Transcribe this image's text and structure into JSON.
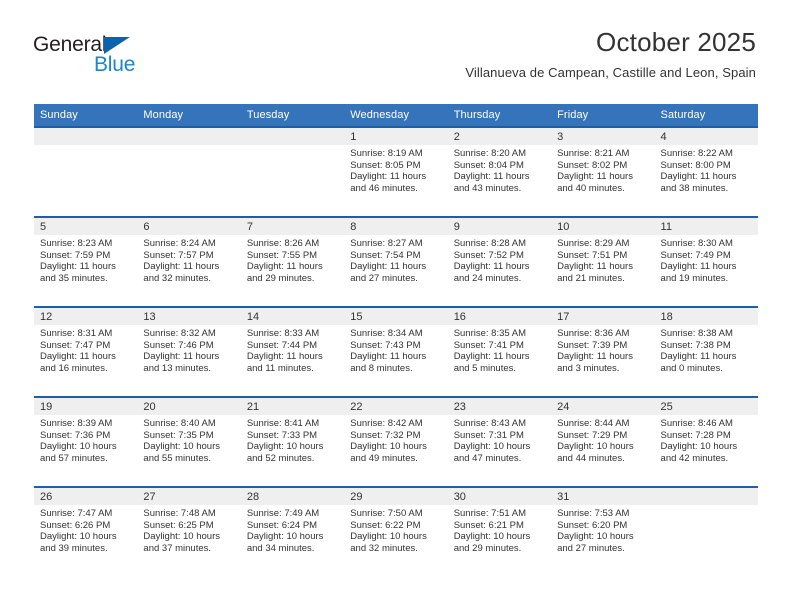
{
  "brand": {
    "name_part1": "General",
    "name_part2": "Blue",
    "accent_color": "#1a86d0",
    "triangle_color": "#0a63ab",
    "text_color": "#231f20"
  },
  "header": {
    "title": "October 2025",
    "subtitle": "Villanueva de Campean, Castille and Leon, Spain"
  },
  "theme": {
    "header_row_bg": "#3573ba",
    "row_divider": "#1c5fa8",
    "daynum_band_bg": "#efefef",
    "text": "#333333"
  },
  "weekdays": [
    "Sunday",
    "Monday",
    "Tuesday",
    "Wednesday",
    "Thursday",
    "Friday",
    "Saturday"
  ],
  "labels": {
    "sunrise": "Sunrise:",
    "sunset": "Sunset:",
    "daylight": "Daylight:"
  },
  "weeks": [
    [
      {
        "day": "",
        "empty": true
      },
      {
        "day": "",
        "empty": true
      },
      {
        "day": "",
        "empty": true
      },
      {
        "day": "1",
        "sunrise": "Sunrise: 8:19 AM",
        "sunset": "Sunset: 8:05 PM",
        "daylight": "Daylight: 11 hours and 46 minutes."
      },
      {
        "day": "2",
        "sunrise": "Sunrise: 8:20 AM",
        "sunset": "Sunset: 8:04 PM",
        "daylight": "Daylight: 11 hours and 43 minutes."
      },
      {
        "day": "3",
        "sunrise": "Sunrise: 8:21 AM",
        "sunset": "Sunset: 8:02 PM",
        "daylight": "Daylight: 11 hours and 40 minutes."
      },
      {
        "day": "4",
        "sunrise": "Sunrise: 8:22 AM",
        "sunset": "Sunset: 8:00 PM",
        "daylight": "Daylight: 11 hours and 38 minutes."
      }
    ],
    [
      {
        "day": "5",
        "sunrise": "Sunrise: 8:23 AM",
        "sunset": "Sunset: 7:59 PM",
        "daylight": "Daylight: 11 hours and 35 minutes."
      },
      {
        "day": "6",
        "sunrise": "Sunrise: 8:24 AM",
        "sunset": "Sunset: 7:57 PM",
        "daylight": "Daylight: 11 hours and 32 minutes."
      },
      {
        "day": "7",
        "sunrise": "Sunrise: 8:26 AM",
        "sunset": "Sunset: 7:55 PM",
        "daylight": "Daylight: 11 hours and 29 minutes."
      },
      {
        "day": "8",
        "sunrise": "Sunrise: 8:27 AM",
        "sunset": "Sunset: 7:54 PM",
        "daylight": "Daylight: 11 hours and 27 minutes."
      },
      {
        "day": "9",
        "sunrise": "Sunrise: 8:28 AM",
        "sunset": "Sunset: 7:52 PM",
        "daylight": "Daylight: 11 hours and 24 minutes."
      },
      {
        "day": "10",
        "sunrise": "Sunrise: 8:29 AM",
        "sunset": "Sunset: 7:51 PM",
        "daylight": "Daylight: 11 hours and 21 minutes."
      },
      {
        "day": "11",
        "sunrise": "Sunrise: 8:30 AM",
        "sunset": "Sunset: 7:49 PM",
        "daylight": "Daylight: 11 hours and 19 minutes."
      }
    ],
    [
      {
        "day": "12",
        "sunrise": "Sunrise: 8:31 AM",
        "sunset": "Sunset: 7:47 PM",
        "daylight": "Daylight: 11 hours and 16 minutes."
      },
      {
        "day": "13",
        "sunrise": "Sunrise: 8:32 AM",
        "sunset": "Sunset: 7:46 PM",
        "daylight": "Daylight: 11 hours and 13 minutes."
      },
      {
        "day": "14",
        "sunrise": "Sunrise: 8:33 AM",
        "sunset": "Sunset: 7:44 PM",
        "daylight": "Daylight: 11 hours and 11 minutes."
      },
      {
        "day": "15",
        "sunrise": "Sunrise: 8:34 AM",
        "sunset": "Sunset: 7:43 PM",
        "daylight": "Daylight: 11 hours and 8 minutes."
      },
      {
        "day": "16",
        "sunrise": "Sunrise: 8:35 AM",
        "sunset": "Sunset: 7:41 PM",
        "daylight": "Daylight: 11 hours and 5 minutes."
      },
      {
        "day": "17",
        "sunrise": "Sunrise: 8:36 AM",
        "sunset": "Sunset: 7:39 PM",
        "daylight": "Daylight: 11 hours and 3 minutes."
      },
      {
        "day": "18",
        "sunrise": "Sunrise: 8:38 AM",
        "sunset": "Sunset: 7:38 PM",
        "daylight": "Daylight: 11 hours and 0 minutes."
      }
    ],
    [
      {
        "day": "19",
        "sunrise": "Sunrise: 8:39 AM",
        "sunset": "Sunset: 7:36 PM",
        "daylight": "Daylight: 10 hours and 57 minutes."
      },
      {
        "day": "20",
        "sunrise": "Sunrise: 8:40 AM",
        "sunset": "Sunset: 7:35 PM",
        "daylight": "Daylight: 10 hours and 55 minutes."
      },
      {
        "day": "21",
        "sunrise": "Sunrise: 8:41 AM",
        "sunset": "Sunset: 7:33 PM",
        "daylight": "Daylight: 10 hours and 52 minutes."
      },
      {
        "day": "22",
        "sunrise": "Sunrise: 8:42 AM",
        "sunset": "Sunset: 7:32 PM",
        "daylight": "Daylight: 10 hours and 49 minutes."
      },
      {
        "day": "23",
        "sunrise": "Sunrise: 8:43 AM",
        "sunset": "Sunset: 7:31 PM",
        "daylight": "Daylight: 10 hours and 47 minutes."
      },
      {
        "day": "24",
        "sunrise": "Sunrise: 8:44 AM",
        "sunset": "Sunset: 7:29 PM",
        "daylight": "Daylight: 10 hours and 44 minutes."
      },
      {
        "day": "25",
        "sunrise": "Sunrise: 8:46 AM",
        "sunset": "Sunset: 7:28 PM",
        "daylight": "Daylight: 10 hours and 42 minutes."
      }
    ],
    [
      {
        "day": "26",
        "sunrise": "Sunrise: 7:47 AM",
        "sunset": "Sunset: 6:26 PM",
        "daylight": "Daylight: 10 hours and 39 minutes."
      },
      {
        "day": "27",
        "sunrise": "Sunrise: 7:48 AM",
        "sunset": "Sunset: 6:25 PM",
        "daylight": "Daylight: 10 hours and 37 minutes."
      },
      {
        "day": "28",
        "sunrise": "Sunrise: 7:49 AM",
        "sunset": "Sunset: 6:24 PM",
        "daylight": "Daylight: 10 hours and 34 minutes."
      },
      {
        "day": "29",
        "sunrise": "Sunrise: 7:50 AM",
        "sunset": "Sunset: 6:22 PM",
        "daylight": "Daylight: 10 hours and 32 minutes."
      },
      {
        "day": "30",
        "sunrise": "Sunrise: 7:51 AM",
        "sunset": "Sunset: 6:21 PM",
        "daylight": "Daylight: 10 hours and 29 minutes."
      },
      {
        "day": "31",
        "sunrise": "Sunrise: 7:53 AM",
        "sunset": "Sunset: 6:20 PM",
        "daylight": "Daylight: 10 hours and 27 minutes."
      },
      {
        "day": "",
        "empty": true
      }
    ]
  ]
}
